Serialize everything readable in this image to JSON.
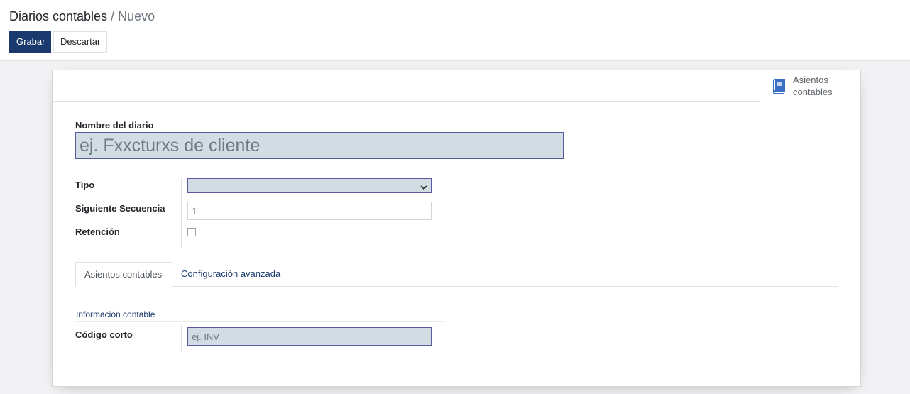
{
  "breadcrumb": {
    "parent": "Diarios contables",
    "separator": " / ",
    "current": "Nuevo"
  },
  "toolbar": {
    "save_label": "Grabar",
    "discard_label": "Descartar"
  },
  "smart_button": {
    "icon": "book-icon",
    "line1": "Asientos",
    "line2": "contables"
  },
  "form": {
    "journal_name": {
      "label": "Nombre del diario",
      "value": "",
      "placeholder": "ej. Fxxcturxs de cliente"
    },
    "type": {
      "label": "Tipo",
      "value": ""
    },
    "next_sequence": {
      "label": "Siguiente Secuencia",
      "value": "1"
    },
    "retention": {
      "label": "Retención",
      "checked": false
    }
  },
  "tabs": [
    {
      "label": "Asientos contables",
      "active": true
    },
    {
      "label": "Configuración avanzada",
      "active": false
    }
  ],
  "accounting_section": {
    "title": "Información contable",
    "short_code": {
      "label": "Código corto",
      "value": "",
      "placeholder": "ej. INV"
    }
  },
  "colors": {
    "primary": "#1a3a6e",
    "required_field_bg": "#d2dde3",
    "page_bg": "#f2f2f4"
  }
}
